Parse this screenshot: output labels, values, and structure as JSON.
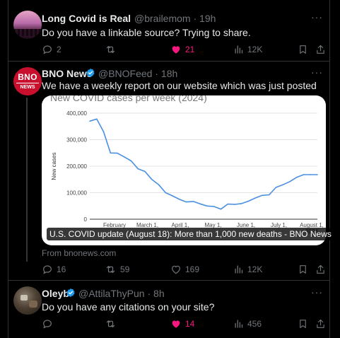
{
  "tweets": [
    {
      "author": "Long Covid is Real",
      "handle": "@brailemom",
      "time": "19h",
      "text": "Do you have a linkable source? Trying to share.",
      "replies": "2",
      "retweets": "",
      "likes": "21",
      "views": "12K",
      "liked": true,
      "verified": false
    },
    {
      "author": "BNO News",
      "handle": "@BNOFeed",
      "time": "18h",
      "text": "We have a weekly report on our website which was just posted",
      "replies": "16",
      "retweets": "59",
      "likes": "169",
      "views": "12K",
      "liked": false,
      "verified": true,
      "avatar_text": {
        "line1": "BNO",
        "line2": "NEWS"
      },
      "card": {
        "caption": "U.S. COVID update (August 18): More than 1,000 new deaths - BNO News",
        "from": "From bnonews.com"
      }
    },
    {
      "author": "Oleyb",
      "handle": "@AttilaThyPun",
      "time": "8h",
      "text": "Do you have any citations on your site?",
      "replies": "",
      "retweets": "",
      "likes": "14",
      "views": "456",
      "liked": true,
      "verified": true
    }
  ],
  "chart_data": {
    "type": "line",
    "title": "New COVID cases per week (2024)",
    "ylabel": "New cases",
    "xlabel": "",
    "ylim": [
      0,
      400000
    ],
    "yticks": [
      "0",
      "100,000",
      "200,000",
      "300,000",
      "400,000"
    ],
    "xticks": [
      {
        "label": "February",
        "year": ""
      },
      {
        "label": "March 1,",
        "year": ""
      },
      {
        "label": "April 1,",
        "year": ""
      },
      {
        "label": "May 1,",
        "year": ""
      },
      {
        "label": "June 1,",
        "year": ""
      },
      {
        "label": "July 1,",
        "year": ""
      },
      {
        "label": "August 1,",
        "year": "2024"
      }
    ],
    "series": [
      {
        "color": "#4a90e2",
        "x": [
          0,
          1,
          2,
          3,
          4,
          5,
          6,
          7,
          8,
          9,
          10,
          11,
          12,
          13,
          14,
          15,
          16,
          17,
          18,
          19,
          20,
          21,
          22,
          23,
          24,
          25,
          26,
          27,
          28,
          29,
          30,
          31,
          32,
          33
        ],
        "values": [
          370000,
          378000,
          330000,
          250000,
          249000,
          235000,
          220000,
          190000,
          180000,
          150000,
          130000,
          100000,
          88000,
          75000,
          65000,
          67000,
          58000,
          50000,
          48000,
          38000,
          57000,
          56000,
          59000,
          68000,
          80000,
          90000,
          92000,
          120000,
          130000,
          142000,
          158000,
          168000,
          168000,
          168000
        ]
      }
    ],
    "colors": {
      "accent": "#1d9bf0",
      "like": "#f91880",
      "muted": "#71767b"
    }
  }
}
